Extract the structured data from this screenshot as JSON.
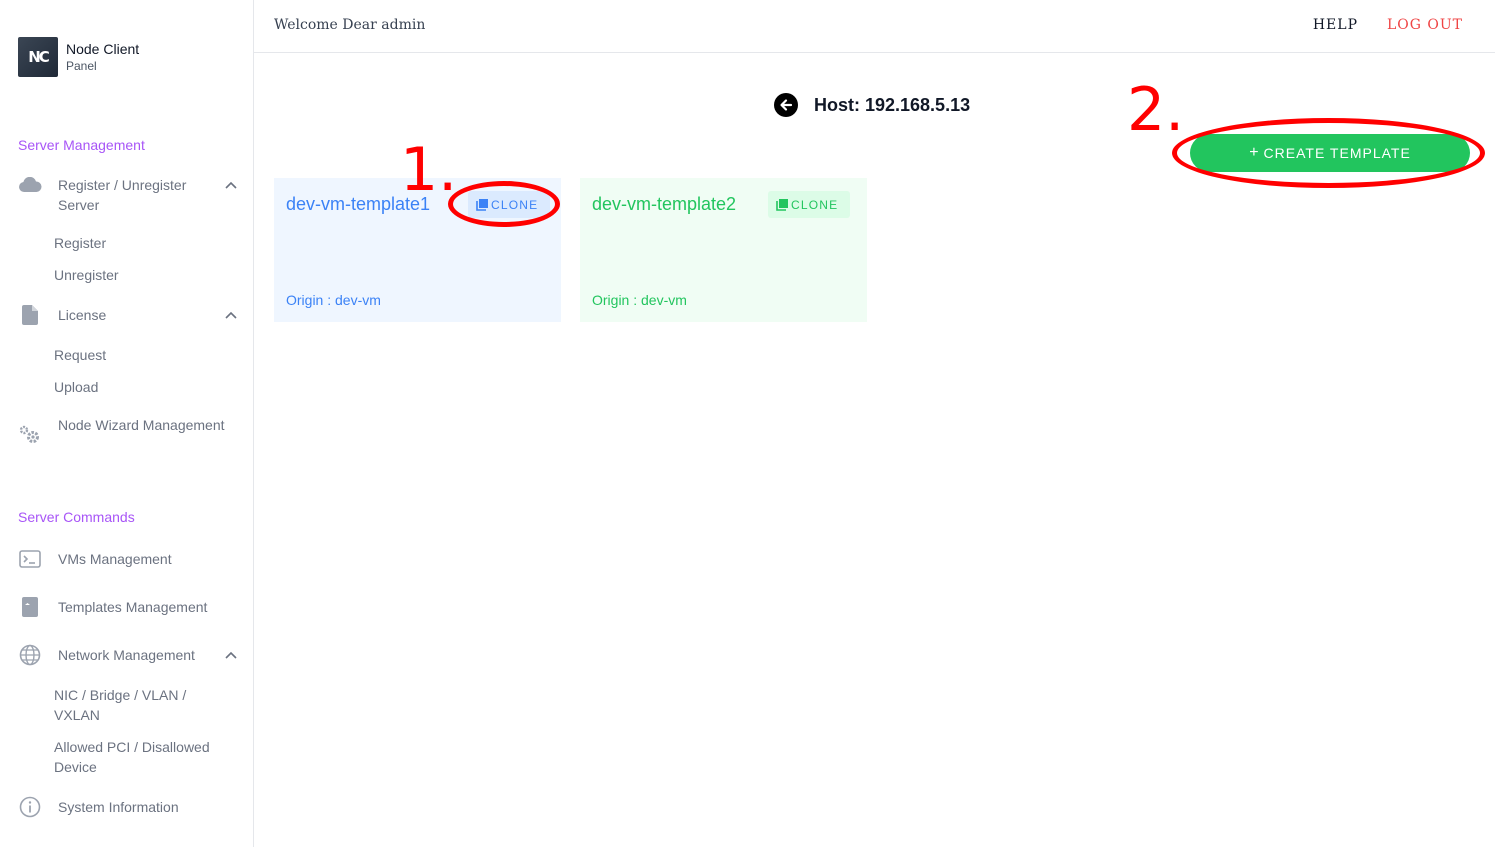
{
  "brand": {
    "logo_text": "NC",
    "title": "Node Client",
    "subtitle": "Panel"
  },
  "sidebar": {
    "sections": [
      {
        "title": "Server Management"
      },
      {
        "title": "Server Commands"
      }
    ],
    "items": {
      "register_unregister": "Register / Unregister Server",
      "register": "Register",
      "unregister": "Unregister",
      "license": "License",
      "request": "Request",
      "upload": "Upload",
      "node_wizard": "Node Wizard Management",
      "vms": "VMs Management",
      "templates": "Templates Management",
      "network": "Network Management",
      "nic": "NIC / Bridge / VLAN / VXLAN",
      "pci": "Allowed PCI / Disallowed Device",
      "system_info": "System Information"
    }
  },
  "header": {
    "welcome": "Welcome Dear admin",
    "help": "HELP",
    "logout": "LOG OUT"
  },
  "main": {
    "host_title": "Host: 192.168.5.13",
    "create_label": "CREATE TEMPLATE",
    "create_plus": "+",
    "cards": [
      {
        "name": "dev-vm-template1",
        "clone_label": "CLONE",
        "origin": "Origin : dev-vm",
        "accent": "#3b82f6"
      },
      {
        "name": "dev-vm-template2",
        "clone_label": "CLONE",
        "origin": "Origin : dev-vm",
        "accent": "#22c55e"
      }
    ]
  },
  "annotations": {
    "step1": "1.",
    "step2": "2.",
    "color": "#ff0000"
  },
  "colors": {
    "section_title": "#a855f7",
    "logout": "#ef4444",
    "create_button": "#22c55e"
  }
}
